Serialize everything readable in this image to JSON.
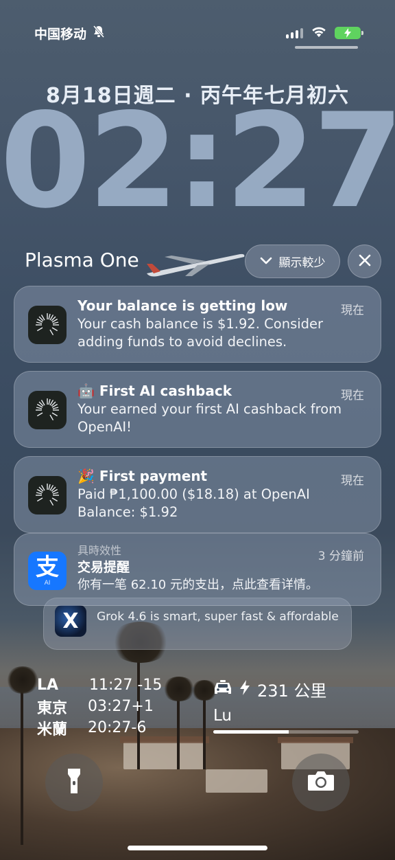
{
  "status_bar": {
    "carrier": "中国移动",
    "icons": [
      "bell-slash-icon",
      "cellular-signal-icon",
      "wifi-icon",
      "battery-charging-icon"
    ],
    "battery_color": "#5fd35f"
  },
  "lock_screen": {
    "date": "8月18日週二 · 丙午年七月初六",
    "time": "02:27"
  },
  "group": {
    "app_name": "Plasma One",
    "show_less_label": "顯示較少",
    "show_less_icon": "chevron-down-icon",
    "close_icon": "close-icon"
  },
  "notifications": [
    {
      "title": "Your balance is getting low",
      "body": "Your cash balance is $1.92. Consider adding funds to avoid declines.",
      "time": "現在",
      "icon": "plasma-app-icon"
    },
    {
      "title": "🤖 First AI cashback",
      "body": "Your earned your first AI cashback from OpenAI!",
      "time": "現在",
      "icon": "plasma-app-icon"
    },
    {
      "title": "🎉 First payment",
      "body_line1": "Paid ₱1,100.00 ($18.18) at OpenAI",
      "body_line2": "Balance: $1.92",
      "time": "現在",
      "icon": "plasma-app-icon"
    }
  ],
  "alipay": {
    "category": "具時效性",
    "title": "交易提醒",
    "body": "你有一笔 62.10 元的支出，点此查看详情。",
    "time": "3 分鐘前",
    "icon_text": "支",
    "icon_sub": "AI",
    "brand_color": "#1677ff"
  },
  "stacked": {
    "icon": "x-app-icon",
    "icon_text": "X",
    "text": "Grok 4.6 is smart, super fast & affordable"
  },
  "world_clocks": [
    {
      "city": "LA",
      "value": "11:27 -15"
    },
    {
      "city": "東京",
      "value": "03:27+1"
    },
    {
      "city": "米蘭",
      "value": "20:27-6"
    }
  ],
  "charging": {
    "icons": [
      "car-icon",
      "bolt-icon"
    ],
    "range": "231 公里",
    "name": "Lu",
    "progress": 0.52
  },
  "bottom_buttons": {
    "left_icon": "flashlight-icon",
    "right_icon": "camera-icon"
  }
}
